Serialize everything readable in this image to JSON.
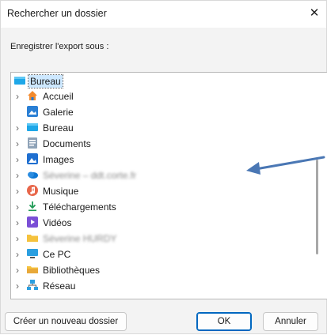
{
  "dialog": {
    "title": "Rechercher un dossier",
    "close_label": "✕",
    "prompt": "Enregistrer l'export sous :"
  },
  "tree": {
    "root": "Bureau",
    "items": [
      {
        "label": "Accueil",
        "icon": "home-icon",
        "expandable": true
      },
      {
        "label": "Galerie",
        "icon": "gallery-icon",
        "expandable": false
      },
      {
        "label": "Bureau",
        "icon": "desktop-folder-icon",
        "expandable": true
      },
      {
        "label": "Documents",
        "icon": "documents-icon",
        "expandable": true
      },
      {
        "label": "Images",
        "icon": "pictures-icon",
        "expandable": true
      },
      {
        "label": "Séverine – ddt.corte.fr",
        "icon": "onedrive-icon",
        "expandable": true,
        "blurred": true
      },
      {
        "label": "Musique",
        "icon": "music-icon",
        "expandable": true
      },
      {
        "label": "Téléchargements",
        "icon": "download-icon",
        "expandable": true
      },
      {
        "label": "Vidéos",
        "icon": "videos-icon",
        "expandable": true
      },
      {
        "label": "Séverine HURDY",
        "icon": "user-folder-icon",
        "expandable": true,
        "blurred": true
      },
      {
        "label": "Ce PC",
        "icon": "this-pc-icon",
        "expandable": true
      },
      {
        "label": "Bibliothèques",
        "icon": "libraries-icon",
        "expandable": true
      },
      {
        "label": "Réseau",
        "icon": "network-icon",
        "expandable": true
      }
    ]
  },
  "buttons": {
    "new_folder": "Créer un nouveau dossier",
    "ok": "OK",
    "cancel": "Annuler"
  },
  "colors": {
    "selection": "#cde8ff",
    "accent": "#0067c0",
    "annotation_arrow": "#4a77b4"
  }
}
